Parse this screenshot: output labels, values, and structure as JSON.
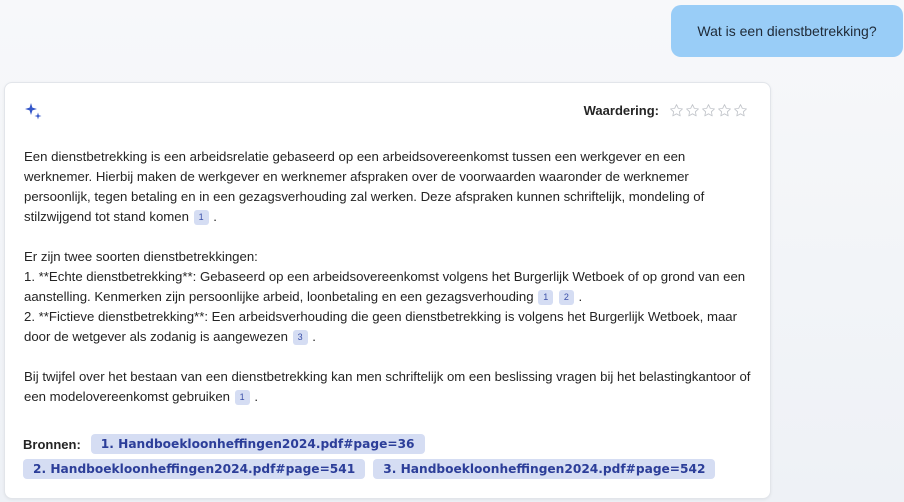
{
  "user_message": "Wat is een dienstbetrekking?",
  "rating": {
    "label": "Waardering:",
    "max_stars": 5,
    "value": 0
  },
  "answer": {
    "p1": "Een dienstbetrekking is een arbeidsrelatie gebaseerd op een arbeidsovereenkomst tussen een werkgever en een werknemer. Hierbij maken de werkgever en werknemer afspraken over de voorwaarden waaronder de werknemer persoonlijk, tegen betaling en in een gezagsverhouding zal werken. Deze afspraken kunnen schriftelijk, mondeling of stilzwijgend tot stand komen",
    "p1_cites": [
      "1"
    ],
    "p2_intro": "Er zijn twee soorten dienstbetrekkingen:",
    "p2_item1": "1. **Echte dienstbetrekking**: Gebaseerd op een arbeidsovereenkomst volgens het Burgerlijk Wetboek of op grond van een aanstelling. Kenmerken zijn persoonlijke arbeid, loonbetaling en een gezagsverhouding",
    "p2_item1_cites": [
      "1",
      "2"
    ],
    "p2_item2": "2. **Fictieve dienstbetrekking**: Een arbeidsverhouding die geen dienstbetrekking is volgens het Burgerlijk Wetboek, maar door de wetgever als zodanig is aangewezen",
    "p2_item2_cites": [
      "3"
    ],
    "p3": "Bij twijfel over het bestaan van een dienstbetrekking kan men schriftelijk om een beslissing vragen bij het belastingkantoor of een modelovereenkomst gebruiken",
    "p3_cites": [
      "1"
    ],
    "period": "."
  },
  "sources": {
    "label": "Bronnen:",
    "items": [
      "1. Handboekloonheffingen2024.pdf#page=36",
      "2. Handboekloonheffingen2024.pdf#page=541",
      "3. Handboekloonheffingen2024.pdf#page=542"
    ]
  },
  "colors": {
    "user_bubble": "#99cdf7",
    "chip_bg": "#d5ddf3",
    "chip_text": "#2c3e99",
    "sparkle": "#3557c9"
  },
  "icons": {
    "assistant": "sparkle-icon",
    "rating": "star-outline-icon"
  }
}
